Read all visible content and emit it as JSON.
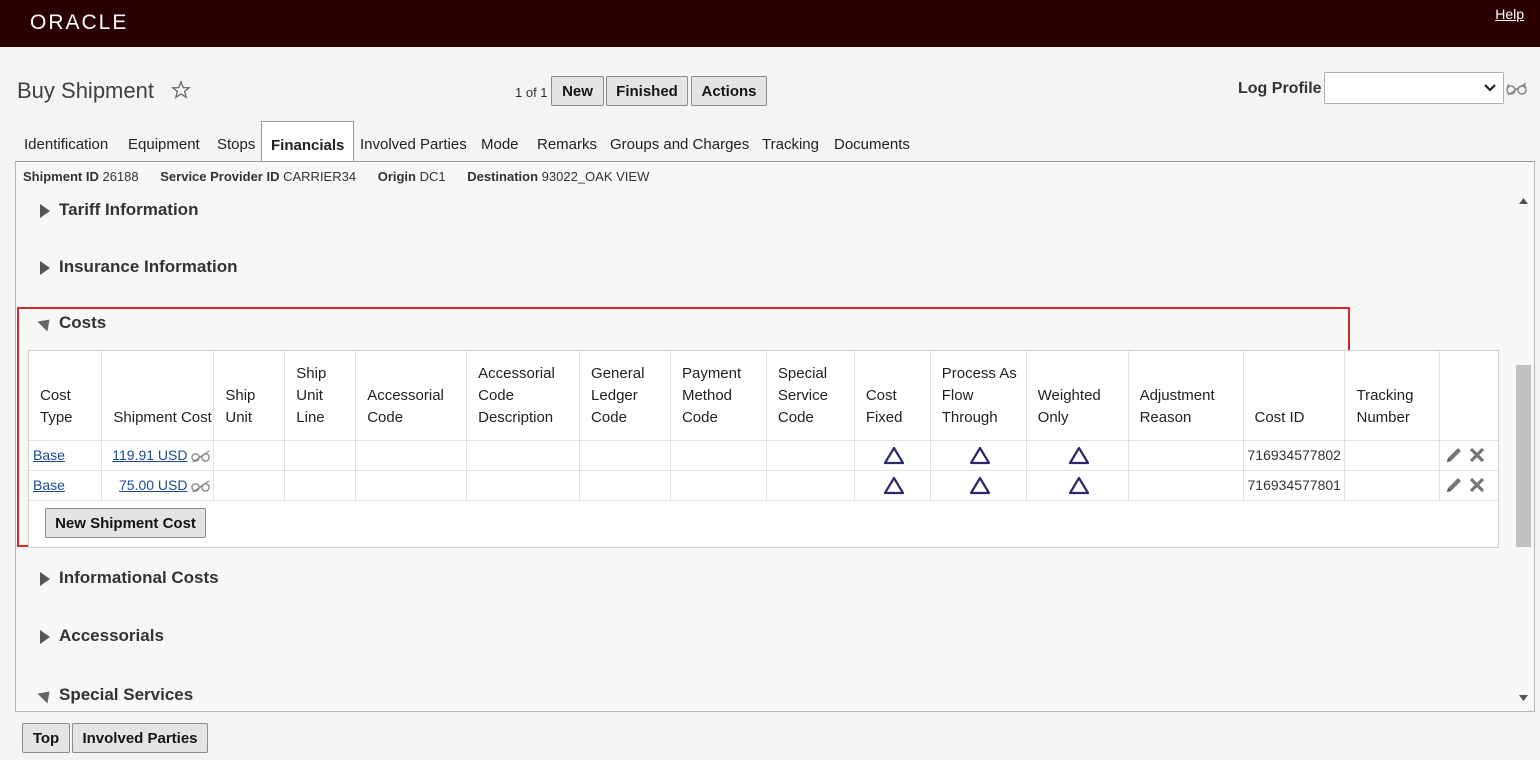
{
  "header": {
    "logo": "ORACLE",
    "help": "Help"
  },
  "page": {
    "title": "Buy Shipment",
    "pager": "1 of 1"
  },
  "toolbar": {
    "new": "New",
    "finished": "Finished",
    "actions": "Actions"
  },
  "log_profile": {
    "label": "Log Profile",
    "value": ""
  },
  "tabs": [
    "Identification",
    "Equipment",
    "Stops",
    "Financials",
    "Involved Parties",
    "Mode",
    "Remarks",
    "Groups and Charges",
    "Tracking",
    "Documents"
  ],
  "active_tab": "Financials",
  "summary": {
    "shipment_id_label": "Shipment ID",
    "shipment_id": "26188",
    "provider_label": "Service Provider ID",
    "provider": "CARRIER34",
    "origin_label": "Origin",
    "origin": "DC1",
    "destination_label": "Destination",
    "destination": "93022_OAK VIEW"
  },
  "sections": {
    "tariff": "Tariff Information",
    "insurance": "Insurance Information",
    "costs": "Costs",
    "informational": "Informational Costs",
    "accessorials": "Accessorials",
    "special": "Special Services"
  },
  "costs_table": {
    "headers": [
      "Cost Type",
      "Shipment Cost",
      "Ship Unit",
      "Ship Unit Line",
      "Accessorial Code",
      "Accessorial Code Description",
      "General Ledger Code",
      "Payment Method Code",
      "Special Service Code",
      "Cost Fixed",
      "Process As Flow Through",
      "Weighted Only",
      "Adjustment Reason",
      "Cost ID",
      "Tracking Number"
    ],
    "rows": [
      {
        "cost_type": "Base",
        "shipment_cost": "119.91 USD",
        "cost_id": "716934577802"
      },
      {
        "cost_type": "Base",
        "shipment_cost": "75.00 USD",
        "cost_id": "716934577801"
      }
    ],
    "new_button": "New Shipment Cost"
  },
  "footer": {
    "top": "Top",
    "involved_parties": "Involved Parties"
  },
  "colors": {
    "header_bg": "#2a0000",
    "highlight": "#d8252f",
    "link": "#1a4c8f"
  }
}
